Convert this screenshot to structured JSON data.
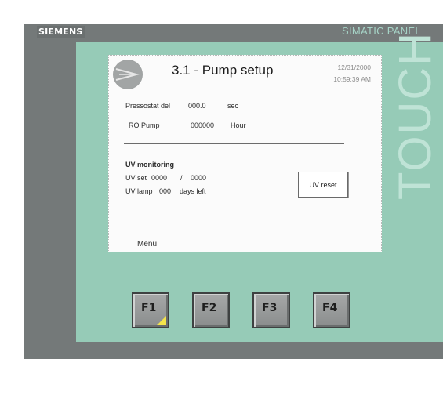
{
  "panel": {
    "brand": "SIEMENS",
    "model": "SIMATIC PANEL",
    "touch_label": "TOUCH"
  },
  "screen": {
    "title": "3.1 - Pump setup",
    "date": "12/31/2000",
    "time": "10:59:39 AM",
    "pressostat": {
      "label": "Pressostat del",
      "value": "000.0",
      "unit": "sec"
    },
    "ro_pump": {
      "label": "RO Pump",
      "value": "000000",
      "unit": "Hour"
    },
    "uv_section": {
      "heading": "UV monitoring",
      "uv_set_label": "UV set",
      "uv_set_value": "0000",
      "separator": "/",
      "uv_set_max": "0000",
      "uv_lamp_label": "UV lamp",
      "uv_lamp_value": "000",
      "uv_lamp_unit": "days left",
      "reset_label": "UV reset"
    },
    "menu_label": "Menu"
  },
  "function_keys": [
    {
      "label": "F1"
    },
    {
      "label": "F2"
    },
    {
      "label": "F3"
    },
    {
      "label": "F4"
    }
  ],
  "colors": {
    "bezel": "#747979",
    "green_surround": "#96cbb7",
    "led": "#f4e44a"
  }
}
